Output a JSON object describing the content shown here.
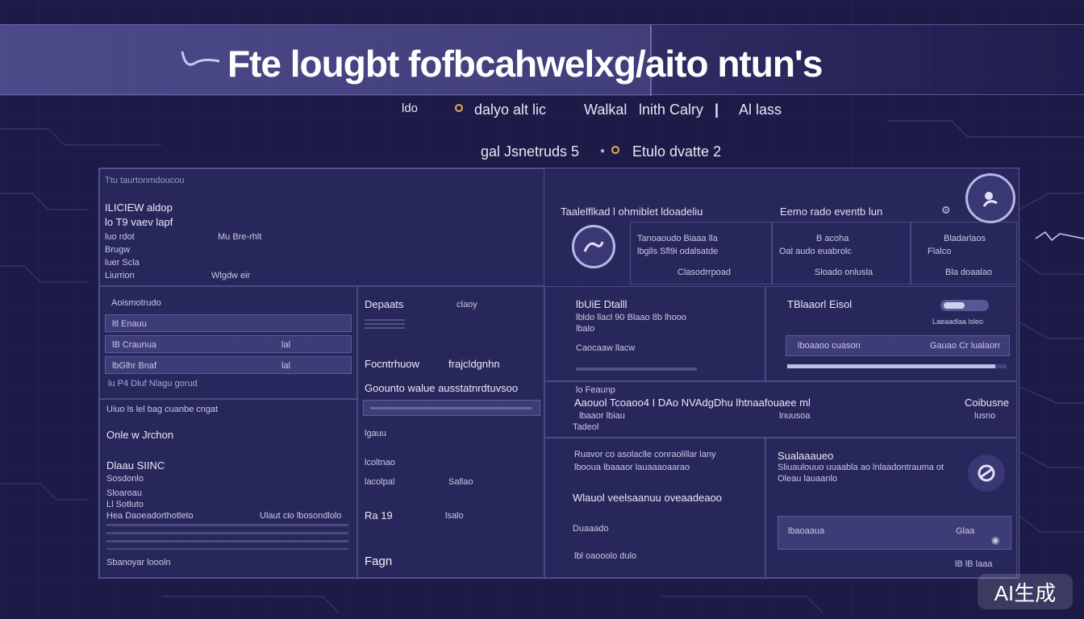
{
  "colors": {
    "background": "#1c1a46",
    "panel": "#2e2c64",
    "accent": "#b8b8e4",
    "text": "#e8e8f8"
  },
  "header": {
    "title": "Fte lougbt fofbcahwelxg/aito ntun's",
    "subtitle_row1": [
      "ldo",
      "dalyo alt lic",
      "Walkal",
      "lnith Calry",
      "Al lass"
    ],
    "subtitle_row2": [
      "gal Jsnetruds 5",
      "Etulo dvatte 2"
    ]
  },
  "left": {
    "top": {
      "line1": "ILICIEW aldop",
      "line2": "lo T9 vaev lapf",
      "line3": "luo rdot",
      "line4": "Brugw",
      "line5": "luer Scla",
      "line6": "Liurrion",
      "meta1": "Mu Bre-rhlt",
      "meta2": "Wlgdw eir",
      "header_tag": "Ttu taurtonmdoucou"
    },
    "list": {
      "header": "Aoismotrudo",
      "rows": [
        {
          "label": "ltl Enauu",
          "value": ""
        },
        {
          "label": "lB Craunua",
          "value": "lal"
        },
        {
          "label": "lbGlhr Bnaf",
          "value": "lal"
        }
      ],
      "footer": "lu P4 Dluf Nlagu gorud"
    },
    "lower": {
      "line1": "Uiuo ls lel bag cuanbe cngat",
      "line2": "Onle w Jrchon",
      "line3": "Dlaau SIINC",
      "line4": "Sosdonlo",
      "line5": "Sloaroau",
      "line6": "Ll Sotluto",
      "line7": "Hea Daoeadorthotleto",
      "line8": "Ulaut cio lbosondlolo",
      "line9": "Sbanoyar loooln"
    }
  },
  "middle": {
    "section1": {
      "label": "Depaats",
      "right": "claoy"
    },
    "section2": {
      "label": "Focntrhuow",
      "right": "frajcldgnhn",
      "caption": "Goounto walue ausstatnrdtuvsoo"
    },
    "section3": {
      "label": "lgauu",
      "caption": "lcoltnao"
    },
    "section4": {
      "label": "lacolpal",
      "value": "Sallao"
    },
    "section5": {
      "label": "Ra 19",
      "value": "lsalo",
      "footer": "Fagn"
    }
  },
  "right_top": {
    "header_left": "Taalelflkad l ohmiblet ldoadeliu",
    "header_right": "Eemo rado eventb lun",
    "cards": [
      {
        "title": "Tanoaoudo Biaaa lla",
        "line": "lbglls Sfl9i odalsatde",
        "foot": "Clasodrrpoad"
      },
      {
        "title": "B acoha",
        "line": "Oal audo euabrolc",
        "foot": "Sloado onlusla"
      },
      {
        "title": "Bladarlaos",
        "line": "Flalco",
        "foot": "Bla doaalao"
      }
    ]
  },
  "right_mid": {
    "title": "lbUiE Dtalll",
    "lines": [
      "lbldo llacl 90 Blaao 8b lhooo",
      "lbalo",
      "Caocaaw llacw"
    ],
    "status": "TBlaaorl Eisol",
    "status_line": "Laeaadlaa lsleo",
    "progress_label": "lboaaoo cuason",
    "progress_right": "Gauao Cr lualaorr",
    "progress_value": 0.95
  },
  "right_lower": {
    "tag": "lo Feaunp",
    "headline": "Aaouol Tcoaoo4 I DAo NVAdgDhu lhtnaafouaee ml",
    "sub1": "lbaaor lbiau",
    "sub2": "Tadeol",
    "right1": "Coibusne",
    "right2": "lusno",
    "right3": "lnuusoa",
    "block1_title": "Ruavor co asolaclle conraolillar lany",
    "block1_line": "lbooua lbaaaor lauaaaoaarao",
    "block2": "Wlauol veelsaanuu oveaadeaoo",
    "block3": "Duaaado",
    "block3_line": "lbl oaooolo dulo",
    "side_title": "Sualaaaueo",
    "side_line1": "Sliuaulouuo uuaabla ao lnlaadontrauma ot",
    "side_line2": "Oleau lauaanlo",
    "side_foot_l": "lbaoaaua",
    "side_foot_r": "Glaa",
    "side_foot2": "lB lB laaa"
  },
  "watermark": "AI生成"
}
